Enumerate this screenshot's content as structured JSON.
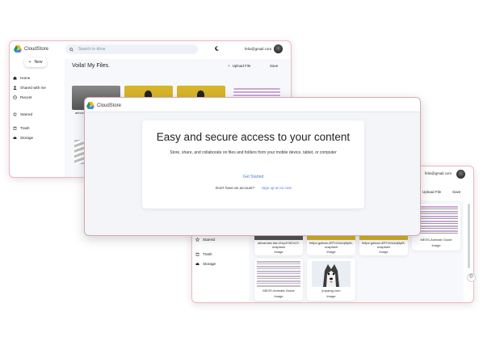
{
  "app": {
    "name": "CloudStore"
  },
  "header": {
    "search_placeholder": "Search in drive",
    "email": "felix@gmail.com",
    "upload_label": "Upload File",
    "save_label": "Save"
  },
  "sidebar": {
    "new_label": "New",
    "items": [
      {
        "label": "Home",
        "icon": "home-icon"
      },
      {
        "label": "Shared with me",
        "icon": "people-icon"
      },
      {
        "label": "Recent",
        "icon": "clock-icon"
      },
      {
        "label": "Starred",
        "icon": "star-icon"
      },
      {
        "label": "Trash",
        "icon": "trash-icon"
      },
      {
        "label": "Storage",
        "icon": "cloud-icon"
      }
    ]
  },
  "main": {
    "title": "Voila! My Files."
  },
  "files_back": [
    {
      "caption": "alexand"
    }
  ],
  "files_right": [
    {
      "name": "alexandra-tran-Ezp4Y6t7dJY-unsplash",
      "type": "Image"
    },
    {
      "name": "felipe-galvan-4RTnVsUqMpM-unsplash",
      "type": "Image"
    },
    {
      "name": "felipe-galvan-4RTnVsUqMpM-unsplash",
      "type": "Image"
    },
    {
      "name": "MESS-Animatir Guide",
      "type": "Image"
    },
    {
      "name": "MESS-Animatir-Guide",
      "type": "Image"
    },
    {
      "name": "jmpamg.com",
      "type": "Image"
    }
  ],
  "hero": {
    "heading": "Easy and secure access to your content",
    "subtext": "Store, share, and collaborate on files and folders from your mobile device, tablet, or computer",
    "cta_label": "Get Started",
    "no_account_text": "Don't have an account?",
    "signup_label": "Sign up at no cost"
  },
  "colors": {
    "accent": "#4c7ddb",
    "window_border": "#f0b8be",
    "search_bg": "#eef2f8",
    "front_bg": "#f3f5f8"
  }
}
